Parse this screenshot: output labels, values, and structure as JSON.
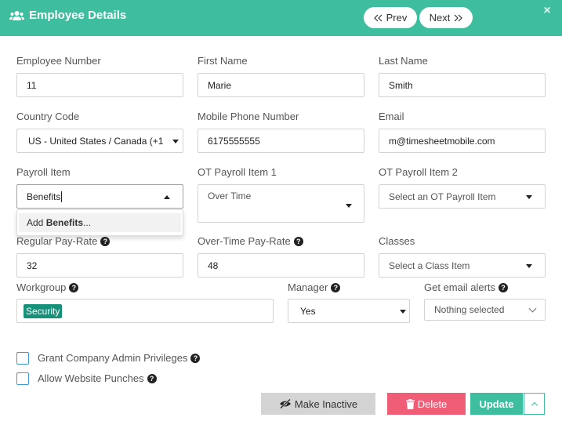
{
  "header": {
    "title": "Employee Details",
    "prev_label": "Prev",
    "next_label": "Next",
    "close_glyph": "×",
    "accent_color": "#3ebd9f"
  },
  "fields": {
    "employee_number": {
      "label": "Employee Number",
      "value": "11"
    },
    "first_name": {
      "label": "First Name",
      "value": "Marie"
    },
    "last_name": {
      "label": "Last Name",
      "value": "Smith"
    },
    "country_code": {
      "label": "Country Code",
      "value": "US - United States / Canada (+1"
    },
    "mobile_phone": {
      "label": "Mobile Phone Number",
      "value": "6175555555"
    },
    "email": {
      "label": "Email",
      "value": "m@timesheetmobile.com"
    },
    "payroll_item": {
      "label": "Payroll Item",
      "value": "Benefits"
    },
    "ot_payroll_item_1": {
      "label": "OT Payroll Item 1",
      "value": "Over Time"
    },
    "ot_payroll_item_2": {
      "label": "OT Payroll Item 2",
      "placeholder": "Select an OT Payroll Item"
    },
    "regular_pay_rate": {
      "label": "Regular Pay-Rate",
      "value": "32"
    },
    "overtime_pay_rate": {
      "label": "Over-Time Pay-Rate",
      "value": "48"
    },
    "classes": {
      "label": "Classes",
      "placeholder": "Select a Class Item"
    },
    "workgroup": {
      "label": "Workgroup",
      "tags": [
        "Security"
      ]
    },
    "manager": {
      "label": "Manager",
      "value": "Yes"
    },
    "email_alerts": {
      "label": "Get email alerts",
      "placeholder": "Nothing selected"
    }
  },
  "payroll_dropdown": {
    "item_prefix": "Add ",
    "item_bold": "Benefits",
    "item_suffix": "..."
  },
  "checkboxes": {
    "admin_privileges": {
      "label": "Grant Company Admin Privileges",
      "checked": false
    },
    "website_punches": {
      "label": "Allow Website Punches",
      "checked": false
    }
  },
  "actions": {
    "make_inactive": "Make Inactive",
    "delete": "Delete",
    "update": "Update",
    "delete_color": "#ef5d77"
  },
  "icons": {
    "title": "users-icon",
    "prev": "double-chevron-left-icon",
    "next": "double-chevron-right-icon",
    "close": "close-icon",
    "help": "question-circle-icon",
    "inactive": "eye-slash-icon",
    "delete": "trash-icon",
    "more": "chevron-up-icon"
  }
}
